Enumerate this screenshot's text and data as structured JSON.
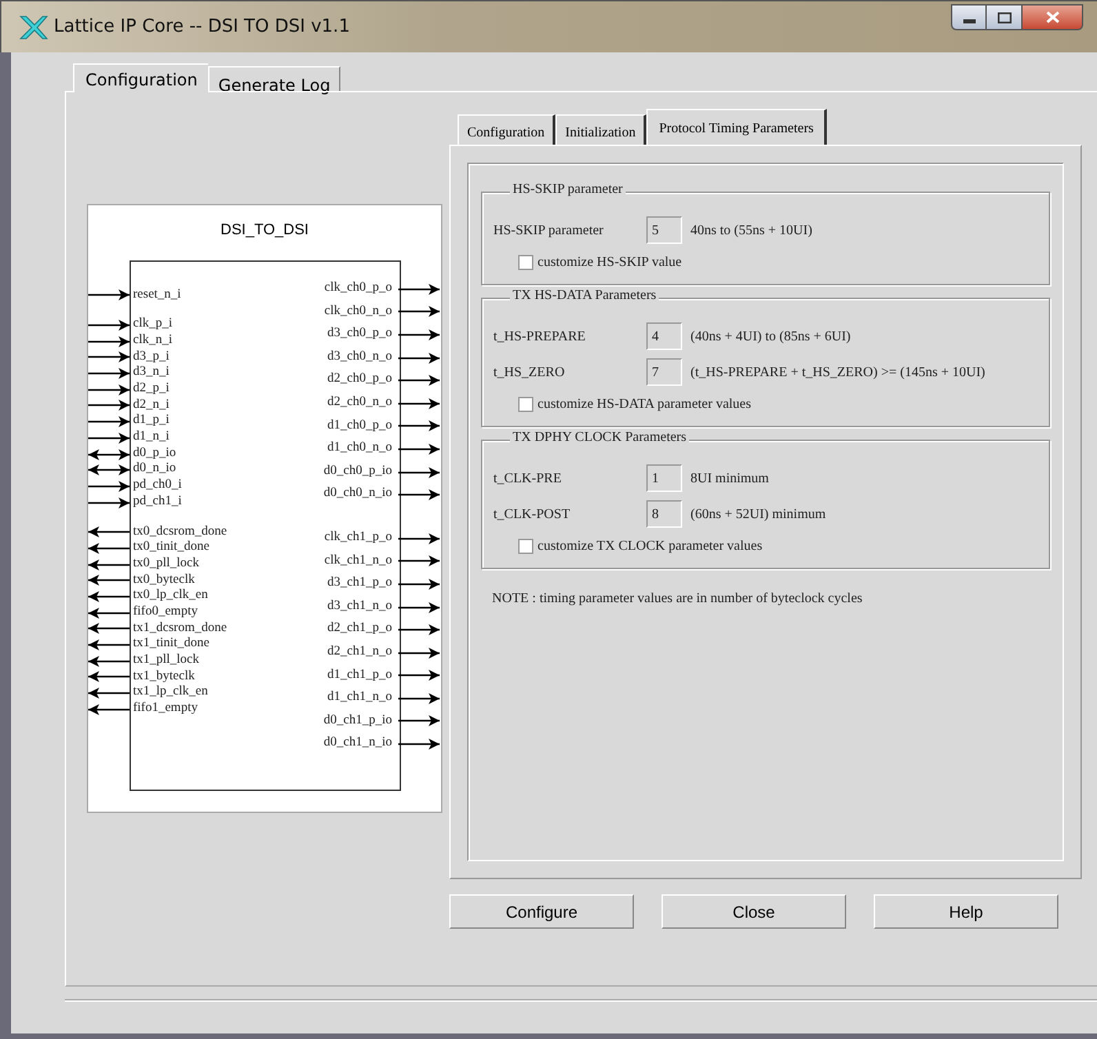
{
  "window": {
    "title": "Lattice IP Core -- DSI TO DSI v1.1"
  },
  "tabs": [
    {
      "label": "Configuration",
      "selected": true
    },
    {
      "label": "Generate Log",
      "selected": false
    }
  ],
  "diagram": {
    "title": "DSI_TO_DSI",
    "left_pin_groups": [
      {
        "pins": [
          {
            "name": "reset_n_i",
            "kind": "in"
          }
        ]
      },
      {
        "pins": [
          {
            "name": "clk_p_i",
            "kind": "in"
          },
          {
            "name": "clk_n_i",
            "kind": "in"
          },
          {
            "name": "d3_p_i",
            "kind": "in"
          },
          {
            "name": "d3_n_i",
            "kind": "in"
          },
          {
            "name": "d2_p_i",
            "kind": "in"
          },
          {
            "name": "d2_n_i",
            "kind": "in"
          },
          {
            "name": "d1_p_i",
            "kind": "in"
          },
          {
            "name": "d1_n_i",
            "kind": "in"
          },
          {
            "name": "d0_p_io",
            "kind": "bidir"
          },
          {
            "name": "d0_n_io",
            "kind": "bidir"
          },
          {
            "name": "pd_ch0_i",
            "kind": "in"
          },
          {
            "name": "pd_ch1_i",
            "kind": "in"
          }
        ]
      },
      {
        "pins": [
          {
            "name": "tx0_dcsrom_done",
            "kind": "out"
          },
          {
            "name": "tx0_tinit_done",
            "kind": "out"
          },
          {
            "name": "tx0_pll_lock",
            "kind": "out"
          },
          {
            "name": "tx0_byteclk",
            "kind": "out"
          },
          {
            "name": "tx0_lp_clk_en",
            "kind": "out"
          },
          {
            "name": "fifo0_empty",
            "kind": "out"
          },
          {
            "name": "tx1_dcsrom_done",
            "kind": "out"
          },
          {
            "name": "tx1_tinit_done",
            "kind": "out"
          },
          {
            "name": "tx1_pll_lock",
            "kind": "out"
          },
          {
            "name": "tx1_byteclk",
            "kind": "out"
          },
          {
            "name": "tx1_lp_clk_en",
            "kind": "out"
          },
          {
            "name": "fifo1_empty",
            "kind": "out"
          }
        ]
      }
    ],
    "right_pin_groups": [
      {
        "pins": [
          {
            "name": "clk_ch0_p_o",
            "kind": "out"
          },
          {
            "name": "clk_ch0_n_o",
            "kind": "out"
          },
          {
            "name": "d3_ch0_p_o",
            "kind": "out"
          },
          {
            "name": "d3_ch0_n_o",
            "kind": "out"
          },
          {
            "name": "d2_ch0_p_o",
            "kind": "out"
          },
          {
            "name": "d2_ch0_n_o",
            "kind": "out"
          },
          {
            "name": "d1_ch0_p_o",
            "kind": "out"
          },
          {
            "name": "d1_ch0_n_o",
            "kind": "out"
          },
          {
            "name": "d0_ch0_p_io",
            "kind": "out"
          },
          {
            "name": "d0_ch0_n_io",
            "kind": "out"
          }
        ]
      },
      {
        "pins": [
          {
            "name": "clk_ch1_p_o",
            "kind": "out"
          },
          {
            "name": "clk_ch1_n_o",
            "kind": "out"
          },
          {
            "name": "d3_ch1_p_o",
            "kind": "out"
          },
          {
            "name": "d3_ch1_n_o",
            "kind": "out"
          },
          {
            "name": "d2_ch1_p_o",
            "kind": "out"
          },
          {
            "name": "d2_ch1_n_o",
            "kind": "out"
          },
          {
            "name": "d1_ch1_p_o",
            "kind": "out"
          },
          {
            "name": "d1_ch1_n_o",
            "kind": "out"
          },
          {
            "name": "d0_ch1_p_io",
            "kind": "out"
          },
          {
            "name": "d0_ch1_n_io",
            "kind": "out"
          }
        ]
      }
    ]
  },
  "inner_tabs": [
    {
      "label": "Configuration",
      "selected": false
    },
    {
      "label": "Initialization",
      "selected": false
    },
    {
      "label": "Protocol Timing Parameters",
      "selected": true
    }
  ],
  "groups": [
    {
      "title": "HS-SKIP parameter",
      "fields": [
        {
          "label": "HS-SKIP parameter",
          "value": "5",
          "hint": "40ns to (55ns + 10UI)"
        }
      ],
      "checkbox": {
        "label": "customize HS-SKIP value",
        "checked": false
      }
    },
    {
      "title": "TX HS-DATA Parameters",
      "fields": [
        {
          "label": "t_HS-PREPARE",
          "value": "4",
          "hint": "(40ns + 4UI) to (85ns + 6UI)"
        },
        {
          "label": "t_HS_ZERO",
          "value": "7",
          "hint": "(t_HS-PREPARE + t_HS_ZERO) >= (145ns + 10UI)"
        }
      ],
      "checkbox": {
        "label": "customize HS-DATA parameter values",
        "checked": false
      }
    },
    {
      "title": "TX DPHY CLOCK Parameters",
      "fields": [
        {
          "label": "t_CLK-PRE",
          "value": "1",
          "hint": "8UI minimum"
        },
        {
          "label": "t_CLK-POST",
          "value": "8",
          "hint": "(60ns + 52UI) minimum"
        }
      ],
      "checkbox": {
        "label": "customize TX CLOCK parameter values",
        "checked": false
      }
    }
  ],
  "note": "NOTE : timing parameter values are in number of byteclock cycles",
  "buttons": [
    "Configure",
    "Close",
    "Help"
  ]
}
